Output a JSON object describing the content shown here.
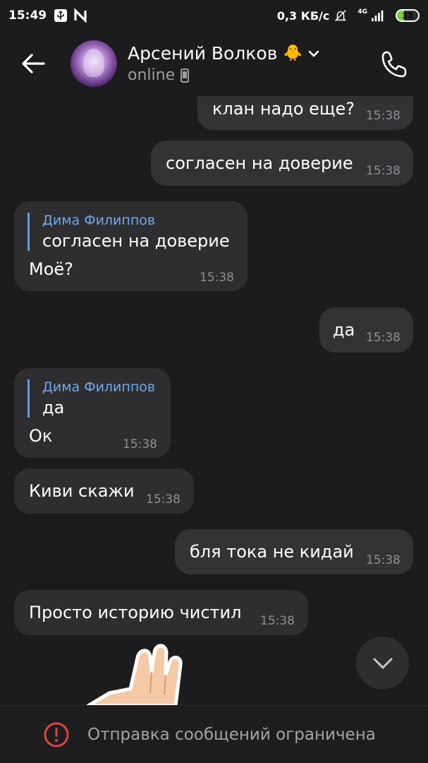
{
  "status_bar": {
    "time": "15:49",
    "speed": "0,3 КБ/с",
    "network": "4G",
    "battery": "32",
    "battery_level": 0.32,
    "icons": [
      "usb-icon",
      "n-icon",
      "silent-icon",
      "signal-icon"
    ]
  },
  "header": {
    "name": "Арсений Волков",
    "emoji": "🐥",
    "status": "online"
  },
  "messages": [
    {
      "id": "m1",
      "dir": "out",
      "text": "клан надо еще?",
      "time": "15:38"
    },
    {
      "id": "m2",
      "dir": "out",
      "text": "согласен на доверие",
      "time": "15:38"
    },
    {
      "id": "m3",
      "dir": "in",
      "reply_name": "Дима Филиппов",
      "reply_text": "согласен на доверие",
      "text": "Моё?",
      "time": "15:38"
    },
    {
      "id": "m4",
      "dir": "out",
      "text": "да",
      "time": "15:38"
    },
    {
      "id": "m5",
      "dir": "in",
      "reply_name": "Дима Филиппов",
      "reply_text": "да",
      "text": "Ок",
      "time": "15:38"
    },
    {
      "id": "m6",
      "dir": "in",
      "text": "Киви скажи",
      "time": "15:38"
    },
    {
      "id": "m7",
      "dir": "out",
      "text": "бля тока не кидай",
      "time": "15:38"
    },
    {
      "id": "m8",
      "dir": "in",
      "text": "Просто историю чистил",
      "time": "15:38"
    }
  ],
  "footer": {
    "text": "Отправка сообщений ограничена"
  },
  "colors": {
    "background": "#1c1c1e",
    "bubble": "#2e2e30",
    "reply_accent": "#6fa8ea",
    "warning": "#e0443a"
  }
}
